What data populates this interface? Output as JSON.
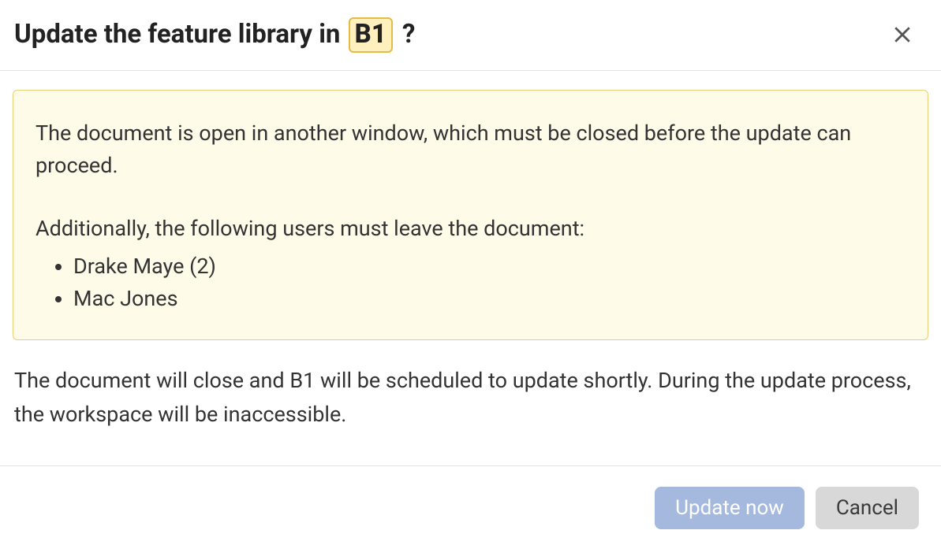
{
  "dialog": {
    "title_prefix": "Update the feature library in ",
    "title_badge": "B1",
    "title_suffix": " ?",
    "warning": {
      "doc_open_message": "The document is open in another window, which must be closed before the update can proceed.",
      "users_intro": "Additionally, the following users must leave the document:",
      "users": [
        "Drake Maye (2)",
        "Mac Jones"
      ]
    },
    "description": "The document will close and B1 will be scheduled to update shortly. During the update process, the workspace will be inaccessible.",
    "buttons": {
      "primary": "Update now",
      "secondary": "Cancel"
    }
  }
}
